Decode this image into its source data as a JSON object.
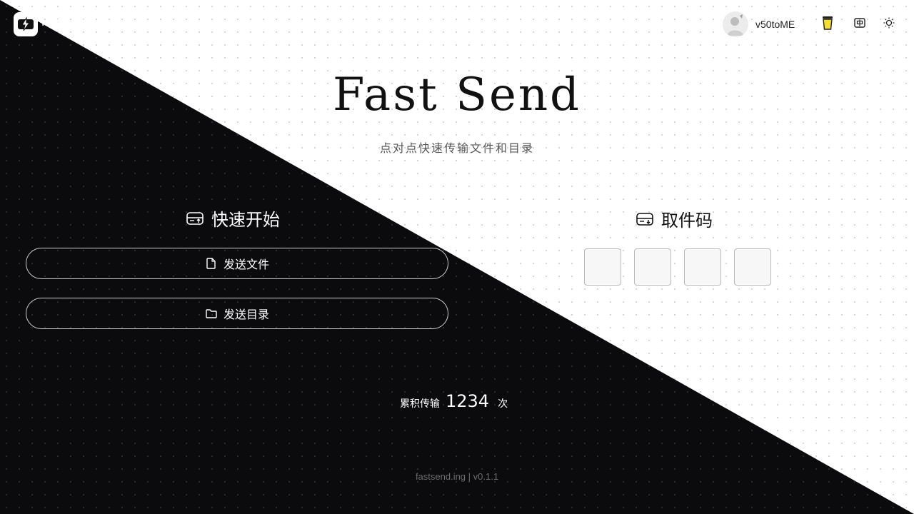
{
  "header": {
    "app_name": "FastSend",
    "user_name": "v50toME",
    "icons": [
      "bolt-logo-icon",
      "cup-icon",
      "language-icon",
      "theme-sun-icon"
    ]
  },
  "hero": {
    "title": "Fast Send",
    "subtitle": "点对点快速传输文件和目录"
  },
  "quick_start": {
    "heading": "快速开始",
    "send_file_label": "发送文件",
    "send_dir_label": "发送目录"
  },
  "pickup": {
    "heading": "取件码",
    "code_digits": [
      "",
      "",
      "",
      ""
    ]
  },
  "stats": {
    "label": "累积传输",
    "count": "1234",
    "unit": "次"
  },
  "footer": {
    "text": "fastsend.ing | v0.1.1"
  },
  "colors": {
    "dark_bg": "#0b0b0d",
    "light_bg": "#ffffff",
    "cup_yellow": "#f5e12a"
  }
}
